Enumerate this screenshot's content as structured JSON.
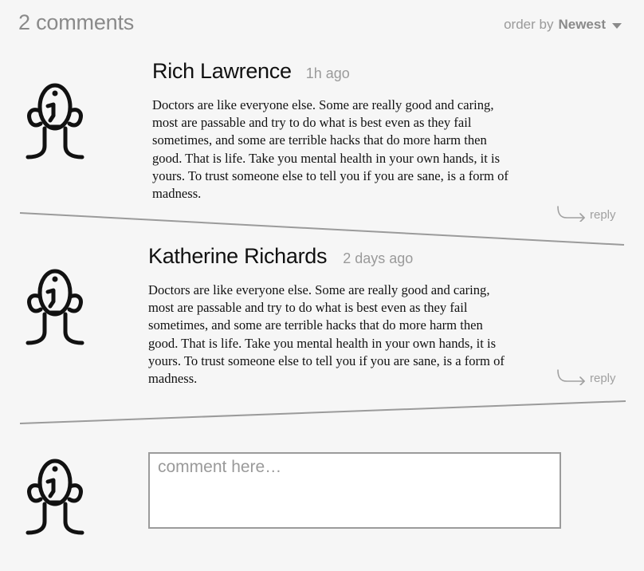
{
  "header": {
    "count_label": "2 comments",
    "order_prefix": "order by",
    "order_value": "Newest"
  },
  "comments": [
    {
      "author": "Rich Lawrence",
      "time": "1h ago",
      "lines": [
        "Doctors are like everyone else. Some are really good and caring,",
        "most are passable and try to do what is best even as they fail",
        "sometimes, and some are terrible hacks that do more harm then",
        "good. That is life. Take you mental health in your own hands, it is",
        "yours. To trust someone else to tell you if you are sane, is a form of",
        "madness."
      ],
      "reply_label": "reply"
    },
    {
      "author": "Katherine Richards",
      "time": "2 days ago",
      "lines": [
        "Doctors are like everyone else. Some are really good and caring,",
        "most are passable and try to do what is best even as they fail",
        "sometimes, and some are terrible hacks that do more harm then",
        "good. That is life. Take you mental health in your own hands, it is",
        "yours. To trust someone else to tell you if you are sane, is a form of",
        "madness."
      ],
      "reply_label": "reply"
    }
  ],
  "composer": {
    "placeholder": "comment here…"
  },
  "icons": {
    "avatar": "avatar-face-icon",
    "reply": "reply-arrow-icon",
    "order": "caret-down-icon"
  },
  "colors": {
    "background": "#f6f6f6",
    "muted": "#9a9a9a",
    "divider": "#9b9b9b"
  }
}
